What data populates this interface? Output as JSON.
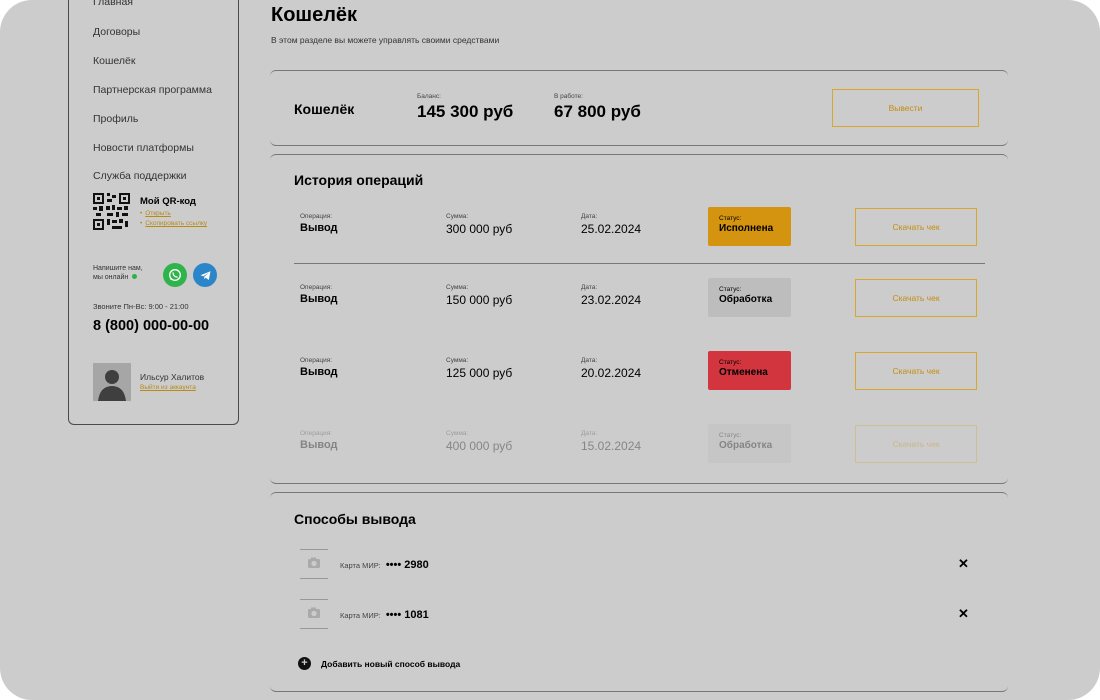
{
  "sidebar": {
    "items": [
      {
        "label": "Главная"
      },
      {
        "label": "Договоры"
      },
      {
        "label": "Кошелёк"
      },
      {
        "label": "Партнерская программа"
      },
      {
        "label": "Профиль"
      },
      {
        "label": "Новости платформы"
      },
      {
        "label": "Служба поддержки"
      }
    ],
    "qr_title": "Мой QR-код",
    "qr_links": [
      "Открыть",
      "Скопировать ссылку"
    ],
    "chat_text_line1": "Напишите нам,",
    "chat_text_line2": "мы онлайн",
    "hours": "Звоните Пн-Вс: 9:00 - 21:00",
    "phone": "8 (800) 000-00-00",
    "user_name": "Ильсур Халитов",
    "logout": "Выйти из аккаунта",
    "accent_color": "#d9a62e"
  },
  "page": {
    "title": "Кошелёк",
    "subtitle": "В этом разделе вы можете управлять своими средствами"
  },
  "wallet": {
    "title": "Кошелёк",
    "balance_label": "Баланс:",
    "balance": "145 300 руб",
    "in_work_label": "В работе:",
    "in_work": "67 800 руб",
    "withdraw_label": "Вывести"
  },
  "history": {
    "title": "История операций",
    "labels": {
      "operation": "Операция:",
      "amount": "Сумма:",
      "date": "Дата:",
      "status": "Статус:"
    },
    "download_label": "Скачать чек",
    "rows": [
      {
        "operation": "Вывод",
        "amount": "300 000 руб",
        "date": "25.02.2024",
        "status": "Исполнена",
        "status_color": "#d4940f"
      },
      {
        "operation": "Вывод",
        "amount": "150 000 руб",
        "date": "23.02.2024",
        "status": "Обработка",
        "status_color": "#bdbdbd"
      },
      {
        "operation": "Вывод",
        "amount": "125 000 руб",
        "date": "20.02.2024",
        "status": "Отменена",
        "status_color": "#d2353e"
      },
      {
        "operation": "Вывод",
        "amount": "400 000 руб",
        "date": "15.02.2024",
        "status": "Обработка",
        "status_color": "#bdbdbd"
      }
    ]
  },
  "methods": {
    "title": "Способы вывода",
    "items": [
      {
        "label": "Карта МИР:",
        "number": "•••• 2980"
      },
      {
        "label": "Карта МИР:",
        "number": "•••• 1081"
      }
    ],
    "add_label": "Добавить новый способ вывода"
  }
}
